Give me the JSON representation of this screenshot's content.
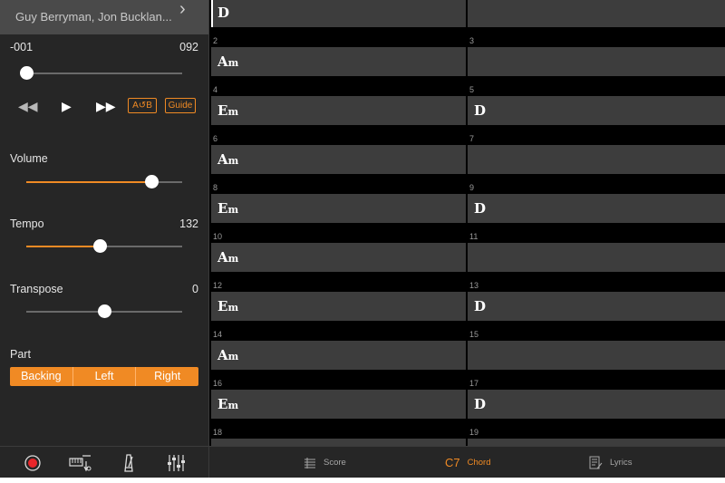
{
  "song": {
    "title": "Guy Berryman, Jon Bucklan..."
  },
  "position": {
    "start": "-001",
    "end": "092",
    "progress": 0.0
  },
  "transport": {
    "ab_label": "A↺B",
    "guide_label": "Guide"
  },
  "volume": {
    "label": "Volume",
    "level": 0.8
  },
  "tempo": {
    "label": "Tempo",
    "value": "132",
    "level": 0.47
  },
  "transpose": {
    "label": "Transpose",
    "value": "0",
    "level": 0.5
  },
  "part": {
    "label": "Part",
    "options": [
      "Backing",
      "Left",
      "Right"
    ]
  },
  "bottom_tabs": [
    {
      "label": "Score",
      "icon": "score-icon",
      "active": false
    },
    {
      "label": "Chord",
      "icon": "chord-icon",
      "active": true
    },
    {
      "label": "Lyrics",
      "icon": "lyrics-icon",
      "active": false
    }
  ],
  "chord_tab_glyph": "C7",
  "bars": [
    {
      "left": {
        "num": "",
        "chord": "D"
      },
      "right": {
        "num": "",
        "chord": ""
      }
    },
    {
      "left": {
        "num": "2",
        "chord": "Am"
      },
      "right": {
        "num": "3",
        "chord": ""
      }
    },
    {
      "left": {
        "num": "4",
        "chord": "Em"
      },
      "right": {
        "num": "5",
        "chord": "D"
      }
    },
    {
      "left": {
        "num": "6",
        "chord": "Am"
      },
      "right": {
        "num": "7",
        "chord": ""
      }
    },
    {
      "left": {
        "num": "8",
        "chord": "Em"
      },
      "right": {
        "num": "9",
        "chord": "D"
      }
    },
    {
      "left": {
        "num": "10",
        "chord": "Am"
      },
      "right": {
        "num": "11",
        "chord": ""
      }
    },
    {
      "left": {
        "num": "12",
        "chord": "Em"
      },
      "right": {
        "num": "13",
        "chord": "D"
      }
    },
    {
      "left": {
        "num": "14",
        "chord": "Am"
      },
      "right": {
        "num": "15",
        "chord": ""
      }
    },
    {
      "left": {
        "num": "16",
        "chord": "Em"
      },
      "right": {
        "num": "17",
        "chord": "D"
      }
    },
    {
      "left": {
        "num": "18",
        "chord": ""
      },
      "right": {
        "num": "19",
        "chord": ""
      }
    }
  ],
  "colors": {
    "accent": "#f08a24",
    "record": "#e8262a",
    "cell": "#3d3d3d",
    "panel": "#262626"
  }
}
